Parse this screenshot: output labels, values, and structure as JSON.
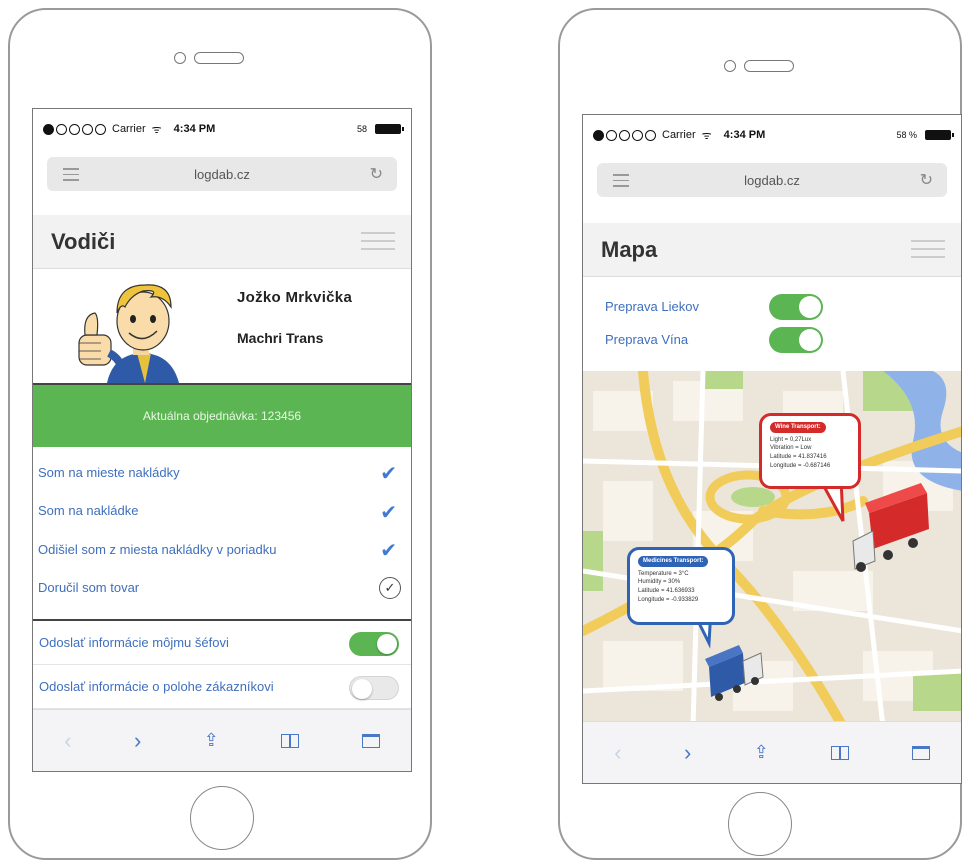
{
  "status": {
    "carrier": "Carrier",
    "time": "4:34 PM",
    "battery_left": "58",
    "battery_right": "58 %",
    "wifi_symbol": "ᯤ"
  },
  "browser": {
    "url": "logdab.cz",
    "reload": "↻"
  },
  "left": {
    "title": "Vodiči",
    "driver_name": "Jožko  Mrkvička",
    "company": "Machri Trans",
    "order": "Aktuálna objednávka:  123456",
    "checklist": [
      {
        "label": "Som na mieste nakládky",
        "done": true
      },
      {
        "label": "Som na nakládke",
        "done": true
      },
      {
        "label": "Odišiel som z miesta nakládky v poriadku",
        "done": true
      },
      {
        "label": "Doručil som tovar",
        "done": false
      }
    ],
    "check_glyph": "✔",
    "circle_glyph": "✓",
    "settings": [
      {
        "label": "Odoslať informácie môjmu šéfovi",
        "on": true
      },
      {
        "label": "Odoslať informácie o polohe zákazníkovi",
        "on": false
      }
    ]
  },
  "right": {
    "title": "Mapa",
    "filters": [
      {
        "label": "Preprava Liekov",
        "on": true
      },
      {
        "label": "Preprava Vína",
        "on": true
      }
    ],
    "wine_bubble": {
      "header": "Wine Transport:",
      "lines": [
        "Light = 0,27Lux",
        "Vibration = Low",
        "Latitude = 41.837416",
        "Longitude = -0.687146"
      ],
      "color": "#d42a2a"
    },
    "medicine_bubble": {
      "header": "Medicines Transport:",
      "lines": [
        "Temperature = 3°C",
        "Humidity = 30%",
        "Latitude = 41.636933",
        "Longitude = -0.933829"
      ],
      "color": "#2f63b5"
    }
  },
  "toolbar": {
    "back": "‹",
    "forward": "›",
    "share": "⇪"
  },
  "colors": {
    "green": "#5cb553",
    "link_blue": "#3f6fbd",
    "wine_red": "#d42a2a",
    "med_blue": "#2f63b5"
  }
}
